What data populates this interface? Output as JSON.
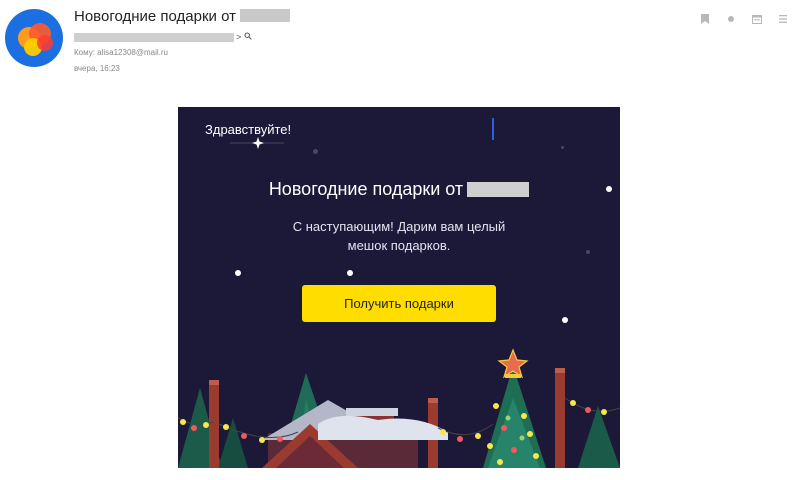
{
  "header": {
    "subject": "Новогодние подарки от",
    "to_label": "Кому: alisa12308@mail.ru",
    "date": "вчера, 16:23",
    "from_chevron": ">",
    "actions": [
      {
        "name": "bookmark-icon"
      },
      {
        "name": "dot-icon"
      },
      {
        "name": "calendar-icon"
      },
      {
        "name": "menu-icon"
      }
    ]
  },
  "email": {
    "greeting": "Здравствуйте!",
    "title": "Новогодние подарки от",
    "lead": "С наступающим! Дарим вам целый мешок подарков.",
    "cta_label": "Получить подарки"
  },
  "colors": {
    "background_dark": "#1c1938",
    "cta": "#ffdd00",
    "avatar_blue": "#1b6fe0"
  }
}
